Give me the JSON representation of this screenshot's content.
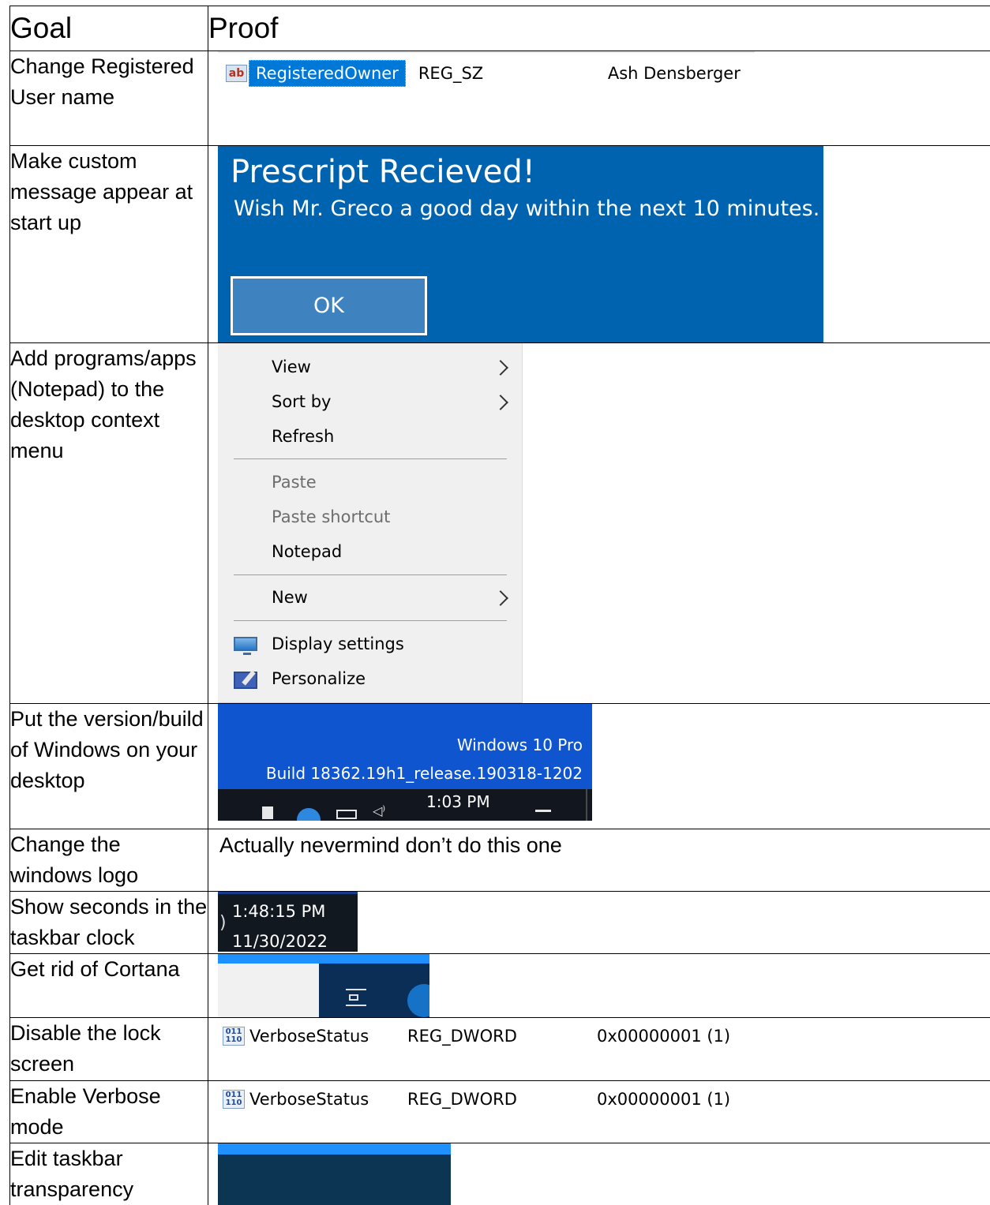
{
  "header": {
    "goal": "Goal",
    "proof": "Proof"
  },
  "rows": [
    {
      "goal": "Change Registered User name",
      "registry": {
        "name": "RegisteredOwner",
        "type": "REG_SZ",
        "data": "Ash Densberger",
        "icon": "string-value-icon"
      }
    },
    {
      "goal": "Make custom message appear at start up",
      "message": {
        "title": "Prescript Recieved!",
        "body": "Wish Mr. Greco a good day within the next 10 minutes.",
        "button": "OK"
      }
    },
    {
      "goal": "Add programs/apps (Notepad) to the desktop context menu",
      "menu": {
        "view": "View",
        "sort_by": "Sort by",
        "refresh": "Refresh",
        "paste": "Paste",
        "paste_shortcut": "Paste shortcut",
        "notepad": "Notepad",
        "new": "New",
        "display_settings": "Display settings",
        "personalize": "Personalize"
      }
    },
    {
      "goal": "Put the version/build of Windows on your desktop",
      "desktop": {
        "version": "Windows 10 Pro",
        "build": "Build 18362.19h1_release.190318-1202",
        "time": "1:03 PM",
        "volume_glyph": "◁⁾"
      }
    },
    {
      "goal": "Change the windows logo",
      "text": "Actually nevermind don’t do this one"
    },
    {
      "goal": "Show seconds in the taskbar clock",
      "clock": {
        "paren": ")",
        "time": "1:48:15 PM",
        "date": "11/30/2022"
      }
    },
    {
      "goal": "Get rid of Cortana"
    },
    {
      "goal": "Disable the lock screen",
      "registry": {
        "name": "VerboseStatus",
        "type": "REG_DWORD",
        "data": "0x00000001 (1)",
        "icon": "binary-value-icon"
      }
    },
    {
      "goal": "Enable Verbose mode",
      "registry": {
        "name": "VerboseStatus",
        "type": "REG_DWORD",
        "data": "0x00000001 (1)",
        "icon": "binary-value-icon"
      }
    },
    {
      "goal": "Edit taskbar transparency"
    }
  ],
  "icons": {
    "string_value_label": "ab",
    "binary_value_label": "011\n110"
  },
  "colors": {
    "message_bg": "#0063af",
    "selection": "#0078d7",
    "desktop_bg": "#0f55cf",
    "taskbar": "#12161f"
  }
}
